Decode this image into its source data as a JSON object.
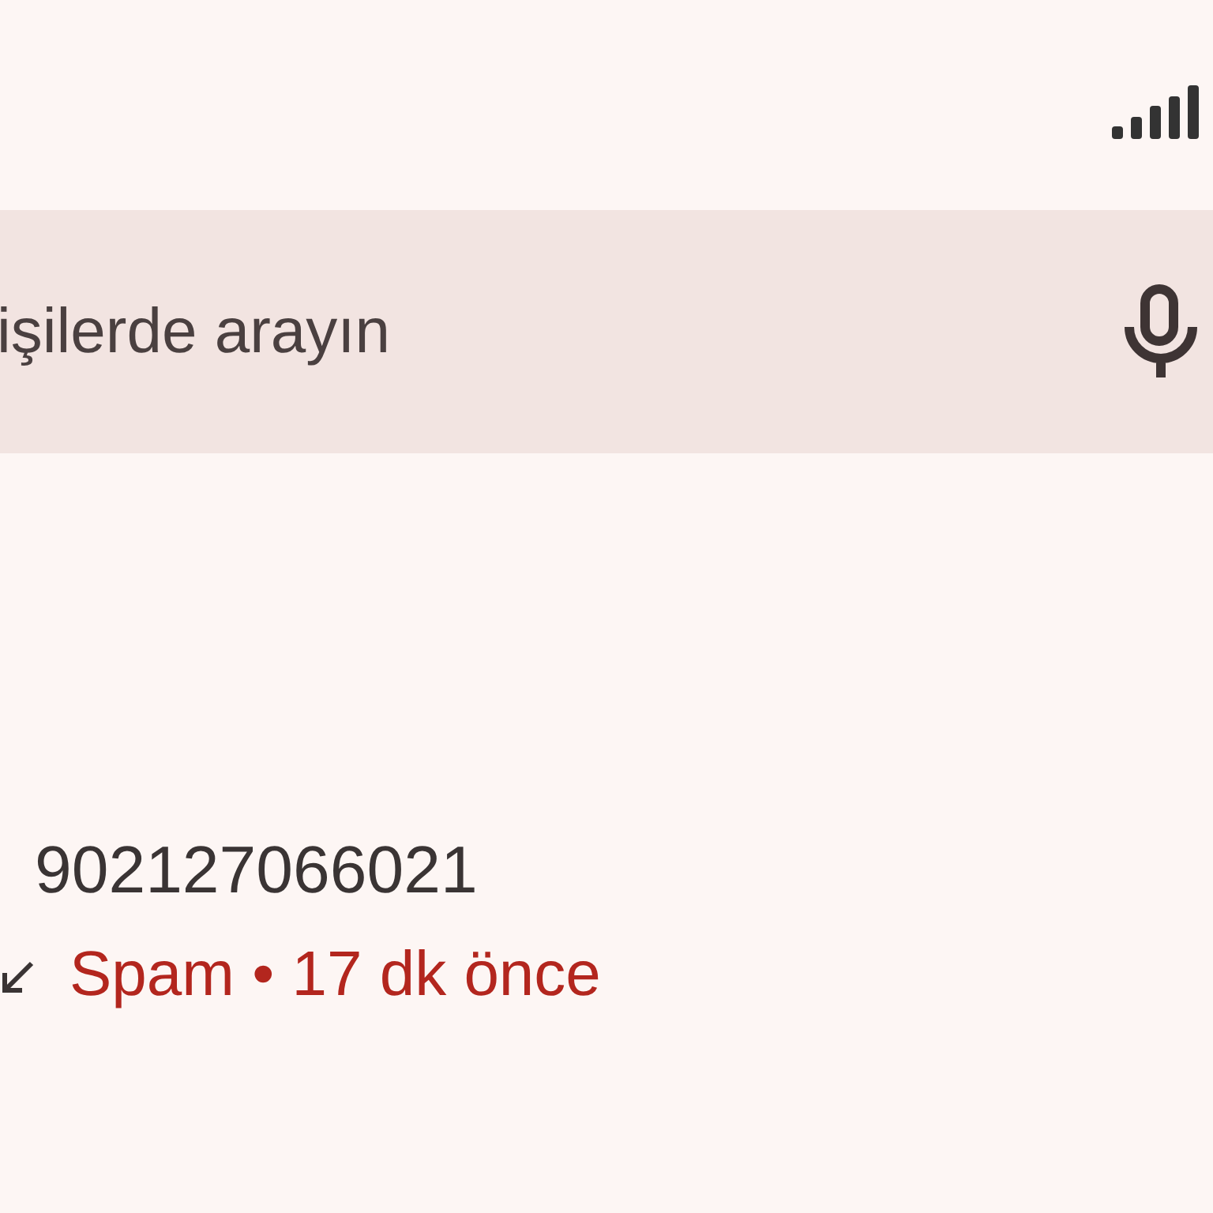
{
  "search": {
    "placeholder": "işilerde arayın"
  },
  "calls": [
    {
      "number": "902127066021",
      "status": "Spam • 17 dk önce",
      "spam": true
    }
  ]
}
